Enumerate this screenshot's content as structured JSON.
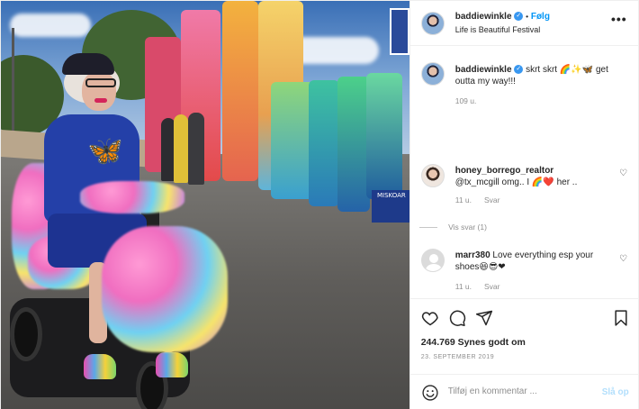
{
  "header": {
    "username": "baddiewinkle",
    "separator": "•",
    "follow_label": "Følg",
    "location": "Life is Beautiful Festival",
    "more_icon": "more-horizontal-icon"
  },
  "caption": {
    "username": "baddiewinkle",
    "text": "skrt skrt 🌈✨🦋 get outta my way!!!",
    "time": "109 u."
  },
  "comments": [
    {
      "username": "honey_borrego_realtor",
      "text": "@tx_mcgill omg.. I 🌈❤️ her ..",
      "time": "11 u.",
      "reply_label": "Svar",
      "view_replies": "Vis svar (1)"
    },
    {
      "username": "marr380",
      "text": "Love everything esp your shoes😆😎❤",
      "time": "11 u.",
      "reply_label": "Svar"
    }
  ],
  "actions": {
    "likes": "244.769 Synes godt om",
    "date": "23. SEPTEMBER 2019"
  },
  "comment_box": {
    "placeholder": "Tilføj en kommentar ...",
    "post_label": "Slå op"
  },
  "photo": {
    "banner_text": "MISKOAR"
  },
  "colors": {
    "link_blue": "#0095f6",
    "verified_blue": "#3897f0",
    "text": "#262626",
    "muted": "#8e8e8e",
    "disabled_blue": "#b2dffc"
  }
}
